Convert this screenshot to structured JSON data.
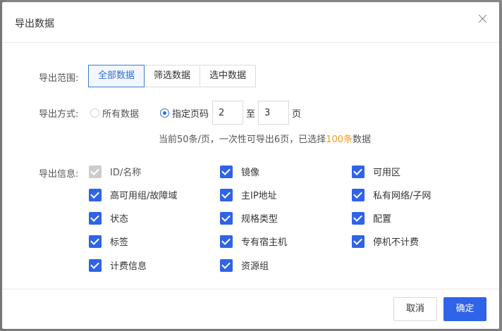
{
  "dialog": {
    "title": "导出数据",
    "close_icon": "close-icon"
  },
  "scope": {
    "label": "导出范围:",
    "options": [
      "全部数据",
      "筛选数据",
      "选中数据"
    ],
    "selected": "全部数据"
  },
  "method": {
    "label": "导出方式:",
    "options": [
      "所有数据",
      "指定页码"
    ],
    "selected": "指定页码",
    "page_from": "2",
    "to_label": "至",
    "page_to": "3",
    "page_suffix": "页"
  },
  "info": {
    "prefix": "当前50条/页，一次性可导出6页，已选择",
    "highlight": "100条",
    "suffix": "数据",
    "highlight_color": "#f39c12"
  },
  "fields": {
    "label": "导出信息:",
    "items": [
      {
        "label": "ID/名称",
        "checked": true,
        "disabled": true
      },
      {
        "label": "镜像",
        "checked": true,
        "disabled": false
      },
      {
        "label": "可用区",
        "checked": true,
        "disabled": false
      },
      {
        "label": "高可用组/故障域",
        "checked": true,
        "disabled": false
      },
      {
        "label": "主IP地址",
        "checked": true,
        "disabled": false
      },
      {
        "label": "私有网络/子网",
        "checked": true,
        "disabled": false
      },
      {
        "label": "状态",
        "checked": true,
        "disabled": false
      },
      {
        "label": "规格类型",
        "checked": true,
        "disabled": false
      },
      {
        "label": "配置",
        "checked": true,
        "disabled": false
      },
      {
        "label": "标签",
        "checked": true,
        "disabled": false
      },
      {
        "label": "专有宿主机",
        "checked": true,
        "disabled": false
      },
      {
        "label": "停机不计费",
        "checked": true,
        "disabled": false
      },
      {
        "label": "计费信息",
        "checked": true,
        "disabled": false
      },
      {
        "label": "资源组",
        "checked": true,
        "disabled": false
      }
    ]
  },
  "footer": {
    "cancel": "取消",
    "ok": "确定"
  },
  "colors": {
    "primary": "#2f63e8",
    "accent_text": "#2f6fd0",
    "disabled": "#cccccc"
  }
}
